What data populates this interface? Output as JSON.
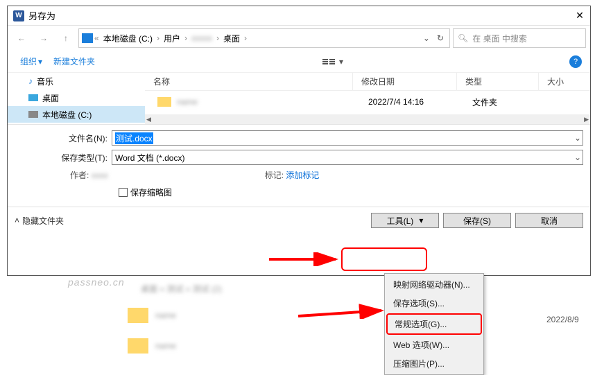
{
  "titlebar": {
    "title": "另存为"
  },
  "path": {
    "drive": "本地磁盘 (C:)",
    "user": "用户",
    "desktop": "桌面"
  },
  "search": {
    "placeholder": "在 桌面 中搜索"
  },
  "toolbar": {
    "organize": "组织",
    "newfolder": "新建文件夹"
  },
  "tree": {
    "music": "音乐",
    "desktop": "桌面",
    "disk": "本地磁盘 (C:)"
  },
  "list": {
    "headers": {
      "name": "名称",
      "modified": "修改日期",
      "type": "类型",
      "size": "大小"
    },
    "rows": [
      {
        "modified": "2022/7/4 14:16",
        "type": "文件夹"
      }
    ]
  },
  "form": {
    "fname_label": "文件名(N):",
    "fname_value": "测试.docx",
    "ftype_label": "保存类型(T):",
    "ftype_value": "Word 文档 (*.docx)",
    "author_label": "作者:",
    "tags_label": "标记:",
    "tags_value": "添加标记",
    "thumb_label": "保存缩略图"
  },
  "footer": {
    "hide": "隐藏文件夹",
    "tool": "工具(L)",
    "save": "保存(S)",
    "cancel": "取消"
  },
  "menu": {
    "m1": "映射网络驱动器(N)...",
    "m2": "保存选项(S)...",
    "m3": "常规选项(G)...",
    "m4": "Web 选项(W)...",
    "m5": "压缩图片(P)..."
  },
  "background": {
    "crumb": "桌面 » 测试 » 测试 (2)",
    "date": "2022/8/9"
  },
  "watermark": "passneo.cn"
}
